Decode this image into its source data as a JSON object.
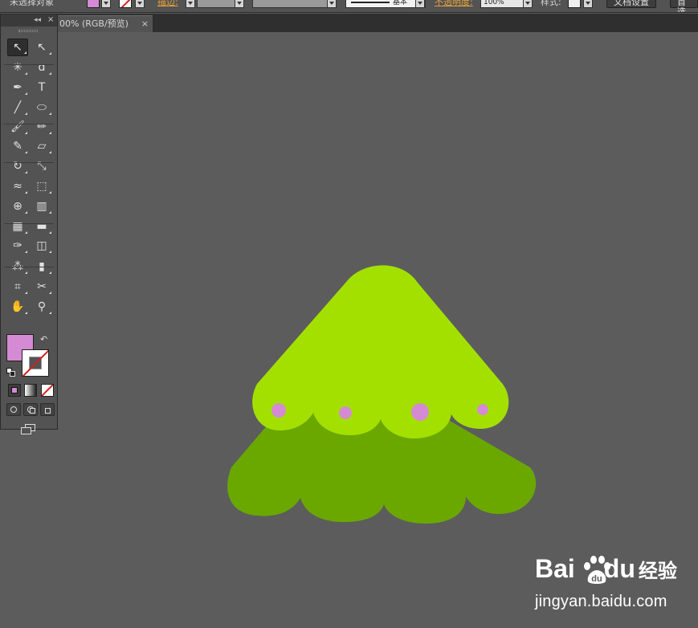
{
  "control_bar": {
    "selection_label": "未选择对象",
    "fill_color": "#d48bd3",
    "stroke_label": "描边:",
    "stroke_profile": "基本",
    "opacity_label": "不透明度:",
    "opacity_value": "100%",
    "style_label": "样式:",
    "doc_setup_button": "文档设置",
    "prefs_button": "首选"
  },
  "document_tab": {
    "title": "00% (RGB/预览)",
    "close_glyph": "×"
  },
  "tools_panel": {
    "collapse_glyph": "◂◂",
    "close_glyph": "×",
    "fill_color": "#d48bd3",
    "stroke": "none",
    "swap_glyph": "↶",
    "tools": [
      {
        "name": "selection-tool",
        "glyph": "↖"
      },
      {
        "name": "direct-selection-tool",
        "glyph": "↖"
      },
      {
        "name": "magic-wand-tool",
        "glyph": "✳"
      },
      {
        "name": "lasso-tool",
        "glyph": "ɑ"
      },
      {
        "name": "pen-tool",
        "glyph": "✒"
      },
      {
        "name": "type-tool",
        "glyph": "T"
      },
      {
        "name": "line-segment-tool",
        "glyph": "╱"
      },
      {
        "name": "ellipse-tool",
        "glyph": "⬭"
      },
      {
        "name": "paintbrush-tool",
        "glyph": "🖌"
      },
      {
        "name": "pencil-tool",
        "glyph": "✏"
      },
      {
        "name": "blob-brush-tool",
        "glyph": "✎"
      },
      {
        "name": "eraser-tool",
        "glyph": "▱"
      },
      {
        "name": "rotate-tool",
        "glyph": "↻"
      },
      {
        "name": "scale-tool",
        "glyph": "⤡"
      },
      {
        "name": "warp-tool",
        "glyph": "≈"
      },
      {
        "name": "free-transform-tool",
        "glyph": "⬚"
      },
      {
        "name": "shape-builder-tool",
        "glyph": "⊕"
      },
      {
        "name": "perspective-grid-tool",
        "glyph": "▥"
      },
      {
        "name": "mesh-tool",
        "glyph": "▦"
      },
      {
        "name": "gradient-tool",
        "glyph": "▬"
      },
      {
        "name": "eyedropper-tool",
        "glyph": "✑"
      },
      {
        "name": "blend-tool",
        "glyph": "◫"
      },
      {
        "name": "symbol-sprayer-tool",
        "glyph": "⁂"
      },
      {
        "name": "column-graph-tool",
        "glyph": "▮"
      },
      {
        "name": "artboard-tool",
        "glyph": "⌗"
      },
      {
        "name": "slice-tool",
        "glyph": "✂"
      },
      {
        "name": "hand-tool",
        "glyph": "✋"
      },
      {
        "name": "zoom-tool",
        "glyph": "⚲"
      }
    ]
  },
  "artwork": {
    "top_layer_color": "#a3e000",
    "bottom_layer_color": "#6aa800",
    "ornament_color": "#d48bd3",
    "canvas_color": "#5c5c5c"
  },
  "watermark": {
    "brand_left": "Bai",
    "brand_right": "du",
    "brand_cn": "经验",
    "url": "jingyan.baidu.com"
  }
}
